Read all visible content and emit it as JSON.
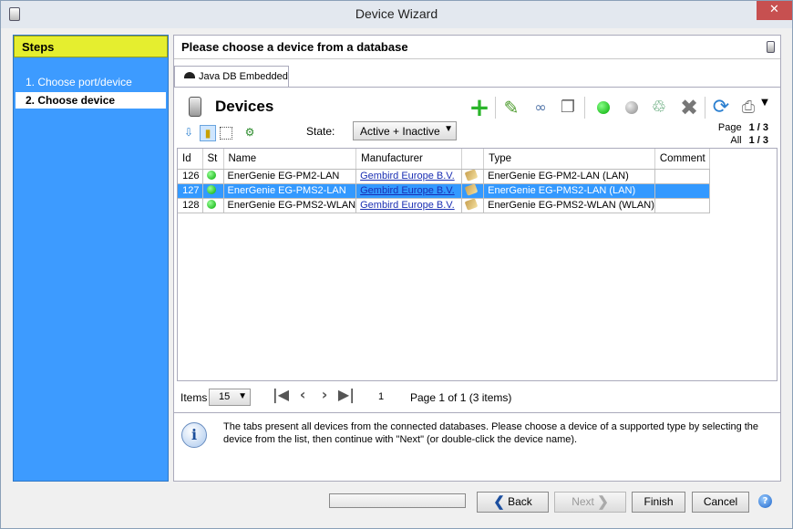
{
  "window": {
    "title": "Device Wizard",
    "close_glyph": "✕"
  },
  "steps": {
    "header": "Steps",
    "items": [
      {
        "label": "1.  Choose port/device"
      },
      {
        "label": "2.  Choose device"
      }
    ]
  },
  "main": {
    "header": "Please choose a device from a database"
  },
  "tab": {
    "label": "Java DB Embedded"
  },
  "devices": {
    "title": "Devices",
    "state_label": "State:",
    "state_value": "Active + Inactive",
    "page_label": "Page",
    "page_value": "1 / 3",
    "all_label": "All",
    "all_value": "1 / 3"
  },
  "table": {
    "columns": [
      "Id",
      "St",
      "Name",
      "Manufacturer",
      "",
      "Type",
      "Comment"
    ],
    "rows": [
      {
        "id": "126",
        "name": "EnerGenie EG-PM2-LAN",
        "manufacturer": "Gembird Europe B.V.",
        "type": "EnerGenie EG-PM2-LAN (LAN)",
        "comment": ""
      },
      {
        "id": "127",
        "name": "EnerGenie EG-PMS2-LAN",
        "manufacturer": "Gembird Europe B.V.",
        "type": "EnerGenie EG-PMS2-LAN (LAN)",
        "comment": ""
      },
      {
        "id": "128",
        "name": "EnerGenie EG-PMS2-WLAN",
        "manufacturer": "Gembird Europe B.V.",
        "type": "EnerGenie EG-PMS2-WLAN (WLAN)",
        "comment": ""
      }
    ]
  },
  "pager": {
    "items_label": "Items",
    "items_value": "15",
    "page_number": "1",
    "page_info": "Page 1 of 1   (3 items)"
  },
  "info": {
    "text": "The tabs present all devices from the connected databases. Please choose a device of a supported type by selecting the device from the list, then continue with \"Next\" (or double-click the device name)."
  },
  "buttons": {
    "back": "Back",
    "next": "Next",
    "finish": "Finish",
    "cancel": "Cancel"
  },
  "colors": {
    "steps_bg": "#3d9bff",
    "steps_header": "#e5ee2f",
    "selection": "#3399ff"
  }
}
